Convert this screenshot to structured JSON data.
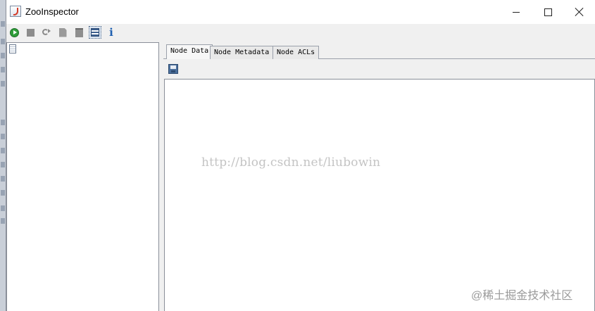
{
  "window": {
    "title": "ZooInspector",
    "controls": [
      "minimize",
      "maximize",
      "close"
    ]
  },
  "toolbar": {
    "buttons": [
      {
        "name": "connect",
        "icon": "connect-icon"
      },
      {
        "name": "disconnect",
        "icon": "stop-icon"
      },
      {
        "name": "refresh",
        "icon": "refresh-icon"
      },
      {
        "name": "add-node",
        "icon": "add-node-icon"
      },
      {
        "name": "delete-node",
        "icon": "delete-node-icon"
      },
      {
        "name": "settings",
        "icon": "settings-icon"
      },
      {
        "name": "about",
        "icon": "info-icon",
        "glyph": "i"
      }
    ]
  },
  "tabs": [
    {
      "label": "Node Data",
      "selected": true
    },
    {
      "label": "Node Metadata",
      "selected": false
    },
    {
      "label": "Node ACLs",
      "selected": false
    }
  ],
  "watermarks": {
    "url": "http://blog.csdn.net/liubowin",
    "community": "@稀土掘金技术社区"
  },
  "colors": {
    "accent_green": "#2f9d3a",
    "info_blue": "#1f5fb0"
  }
}
